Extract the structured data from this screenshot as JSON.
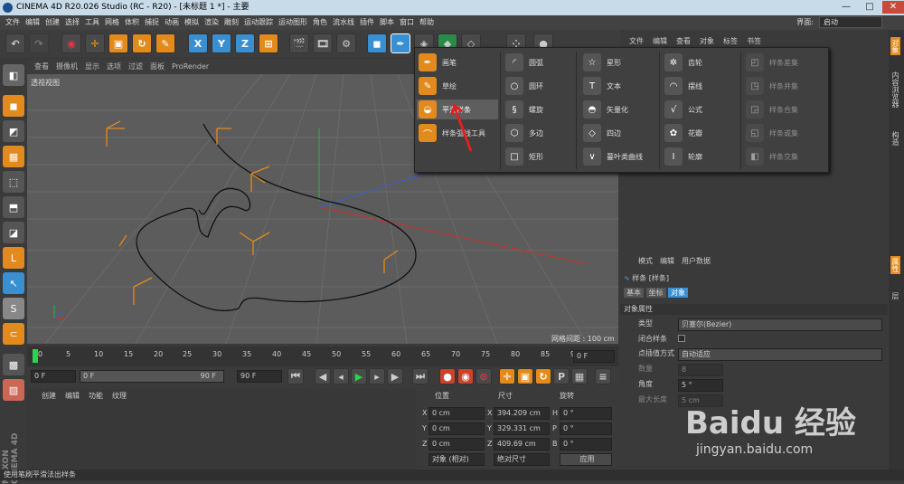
{
  "title": "CINEMA 4D R20.026 Studio (RC - R20) - [未标题 1 *] - 主要",
  "menu": [
    "文件",
    "编辑",
    "创建",
    "选择",
    "工具",
    "网格",
    "体积",
    "捕捉",
    "动画",
    "模拟",
    "渲染",
    "雕刻",
    "运动跟踪",
    "运动图形",
    "角色",
    "流水线",
    "插件",
    "脚本",
    "窗口",
    "帮助"
  ],
  "layout_label": "界面:",
  "layout_value": "启动",
  "toolbar": {
    "x": "X",
    "y": "Y",
    "z": "Z"
  },
  "viewport_menu": [
    "查看",
    "摄像机",
    "显示",
    "选项",
    "过滤",
    "面板",
    "ProRender"
  ],
  "viewport_label": "透视视图",
  "grid_info": "网格间距 : 100 cm",
  "timeline_ticks": [
    "0",
    "5",
    "10",
    "15",
    "20",
    "25",
    "30",
    "35",
    "40",
    "45",
    "50",
    "55",
    "60",
    "65",
    "70",
    "75",
    "80",
    "85",
    "90"
  ],
  "frame_field": "0 F",
  "start_field": "0 F",
  "range_left": "0 F",
  "range_right": "90 F",
  "end_field": "90 F",
  "material_menu": [
    "创建",
    "编辑",
    "功能",
    "纹理"
  ],
  "coord": {
    "headers": [
      "位置",
      "尺寸",
      "旋转"
    ],
    "rows": [
      [
        "X",
        "0 cm",
        "X",
        "394.209 cm",
        "H",
        "0 °"
      ],
      [
        "Y",
        "0 cm",
        "Y",
        "329.331 cm",
        "P",
        "0 °"
      ],
      [
        "Z",
        "0 cm",
        "Z",
        "409.69 cm",
        "B",
        "0 °"
      ]
    ],
    "mode1": "对象 (相对)",
    "mode2": "绝对尺寸",
    "apply": "应用"
  },
  "object_menu": [
    "文件",
    "编辑",
    "查看",
    "对象",
    "标签",
    "书签"
  ],
  "attr_menu": [
    "模式",
    "编辑",
    "用户数据"
  ],
  "attr_title": "样条 [样条]",
  "attr_tabs": [
    "基本",
    "坐标",
    "对象"
  ],
  "attr_section": "对象属性",
  "attr_rows": [
    {
      "label": "类型",
      "value": "贝塞尔(Bezier)"
    },
    {
      "label": "闭合样条",
      "value": ""
    },
    {
      "label": "点插值方式",
      "value": "自动适应"
    },
    {
      "label": "数量",
      "value": "8"
    },
    {
      "label": "角度",
      "value": "5 °"
    },
    {
      "label": "最大长度",
      "value": "5 cm"
    }
  ],
  "popup": {
    "col1": [
      "画笔",
      "草绘",
      "平滑样条",
      "样条弧线工具"
    ],
    "col2": [
      "圆弧",
      "圆环",
      "螺旋",
      "多边",
      "矩形"
    ],
    "col3": [
      "星形",
      "文本",
      "矢量化",
      "四边",
      "蔓叶类曲线"
    ],
    "col4": [
      "齿轮",
      "摆线",
      "公式",
      "花瓣",
      "轮廓"
    ],
    "col5": [
      "样条差集",
      "样条并集",
      "样条合集",
      "样条或集",
      "样条交集"
    ]
  },
  "status": "使用笔刷平滑法出样条",
  "right_tabs": [
    "对象",
    "内容浏览器",
    "构造"
  ],
  "right_tabs2": [
    "属性",
    "层"
  ],
  "side_brand": "MAXON CINEMA 4D",
  "watermark": "Baidu 经验",
  "watermark_url": "jingyan.baidu.com",
  "colors": {
    "accent": "#e38a1c",
    "blue": "#3a8fd0",
    "viewport": "#5c5c5c"
  }
}
